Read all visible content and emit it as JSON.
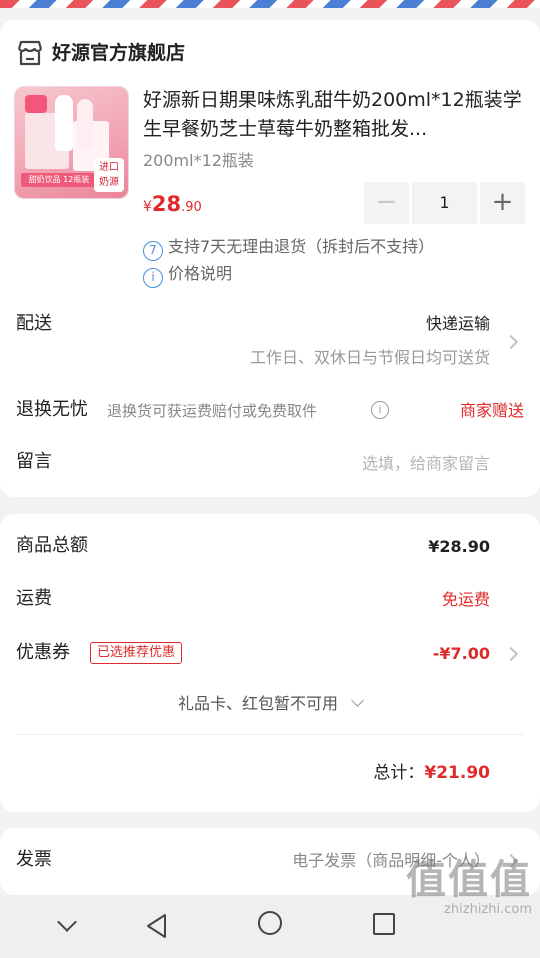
{
  "store": {
    "name": "好源官方旗舰店",
    "icon": "store-icon"
  },
  "product": {
    "title": "好源新日期果味炼乳甜牛奶200ml*12瓶装学生早餐奶芝士草莓牛奶整箱批发...",
    "spec": "200ml*12瓶装",
    "price_currency": "¥",
    "price_int": "28",
    "price_dec": ".90",
    "quantity": "1",
    "thumb_banner": "甜奶饮品 12瓶装",
    "thumb_tag_line1": "进口",
    "thumb_tag_line2": "奶源"
  },
  "policies": [
    {
      "icon": "seven-day-return-icon",
      "icon_text": "7",
      "text": "支持7天无理由退货（拆封后不支持）"
    },
    {
      "icon": "info-icon",
      "icon_text": "i",
      "text": "价格说明"
    }
  ],
  "delivery": {
    "label": "配送",
    "method": "快递运输",
    "note": "工作日、双休日与节假日均可送货"
  },
  "return_worry_free": {
    "label": "退换无忧",
    "desc": "退换货可获运费赔付或免费取件",
    "value": "商家赠送"
  },
  "message": {
    "label": "留言",
    "placeholder": "选填，给商家留言"
  },
  "summary": {
    "goods_total_label": "商品总额",
    "goods_total_value": "¥28.90",
    "shipping_label": "运费",
    "shipping_value": "免运费",
    "coupon_label": "优惠券",
    "coupon_badge": "已选推荐优惠",
    "coupon_value": "-¥7.00",
    "gift_card_note": "礼品卡、红包暂不可用",
    "total_label": "总计：",
    "total_value": "¥21.90"
  },
  "invoice": {
    "label": "发票",
    "value": "电子发票（商品明细-个人）"
  },
  "watermark": {
    "logo": "值值值",
    "url": "zhizhizhi.com"
  },
  "colors": {
    "accent_red": "#e02b2b",
    "info_blue": "#4a90d9"
  }
}
